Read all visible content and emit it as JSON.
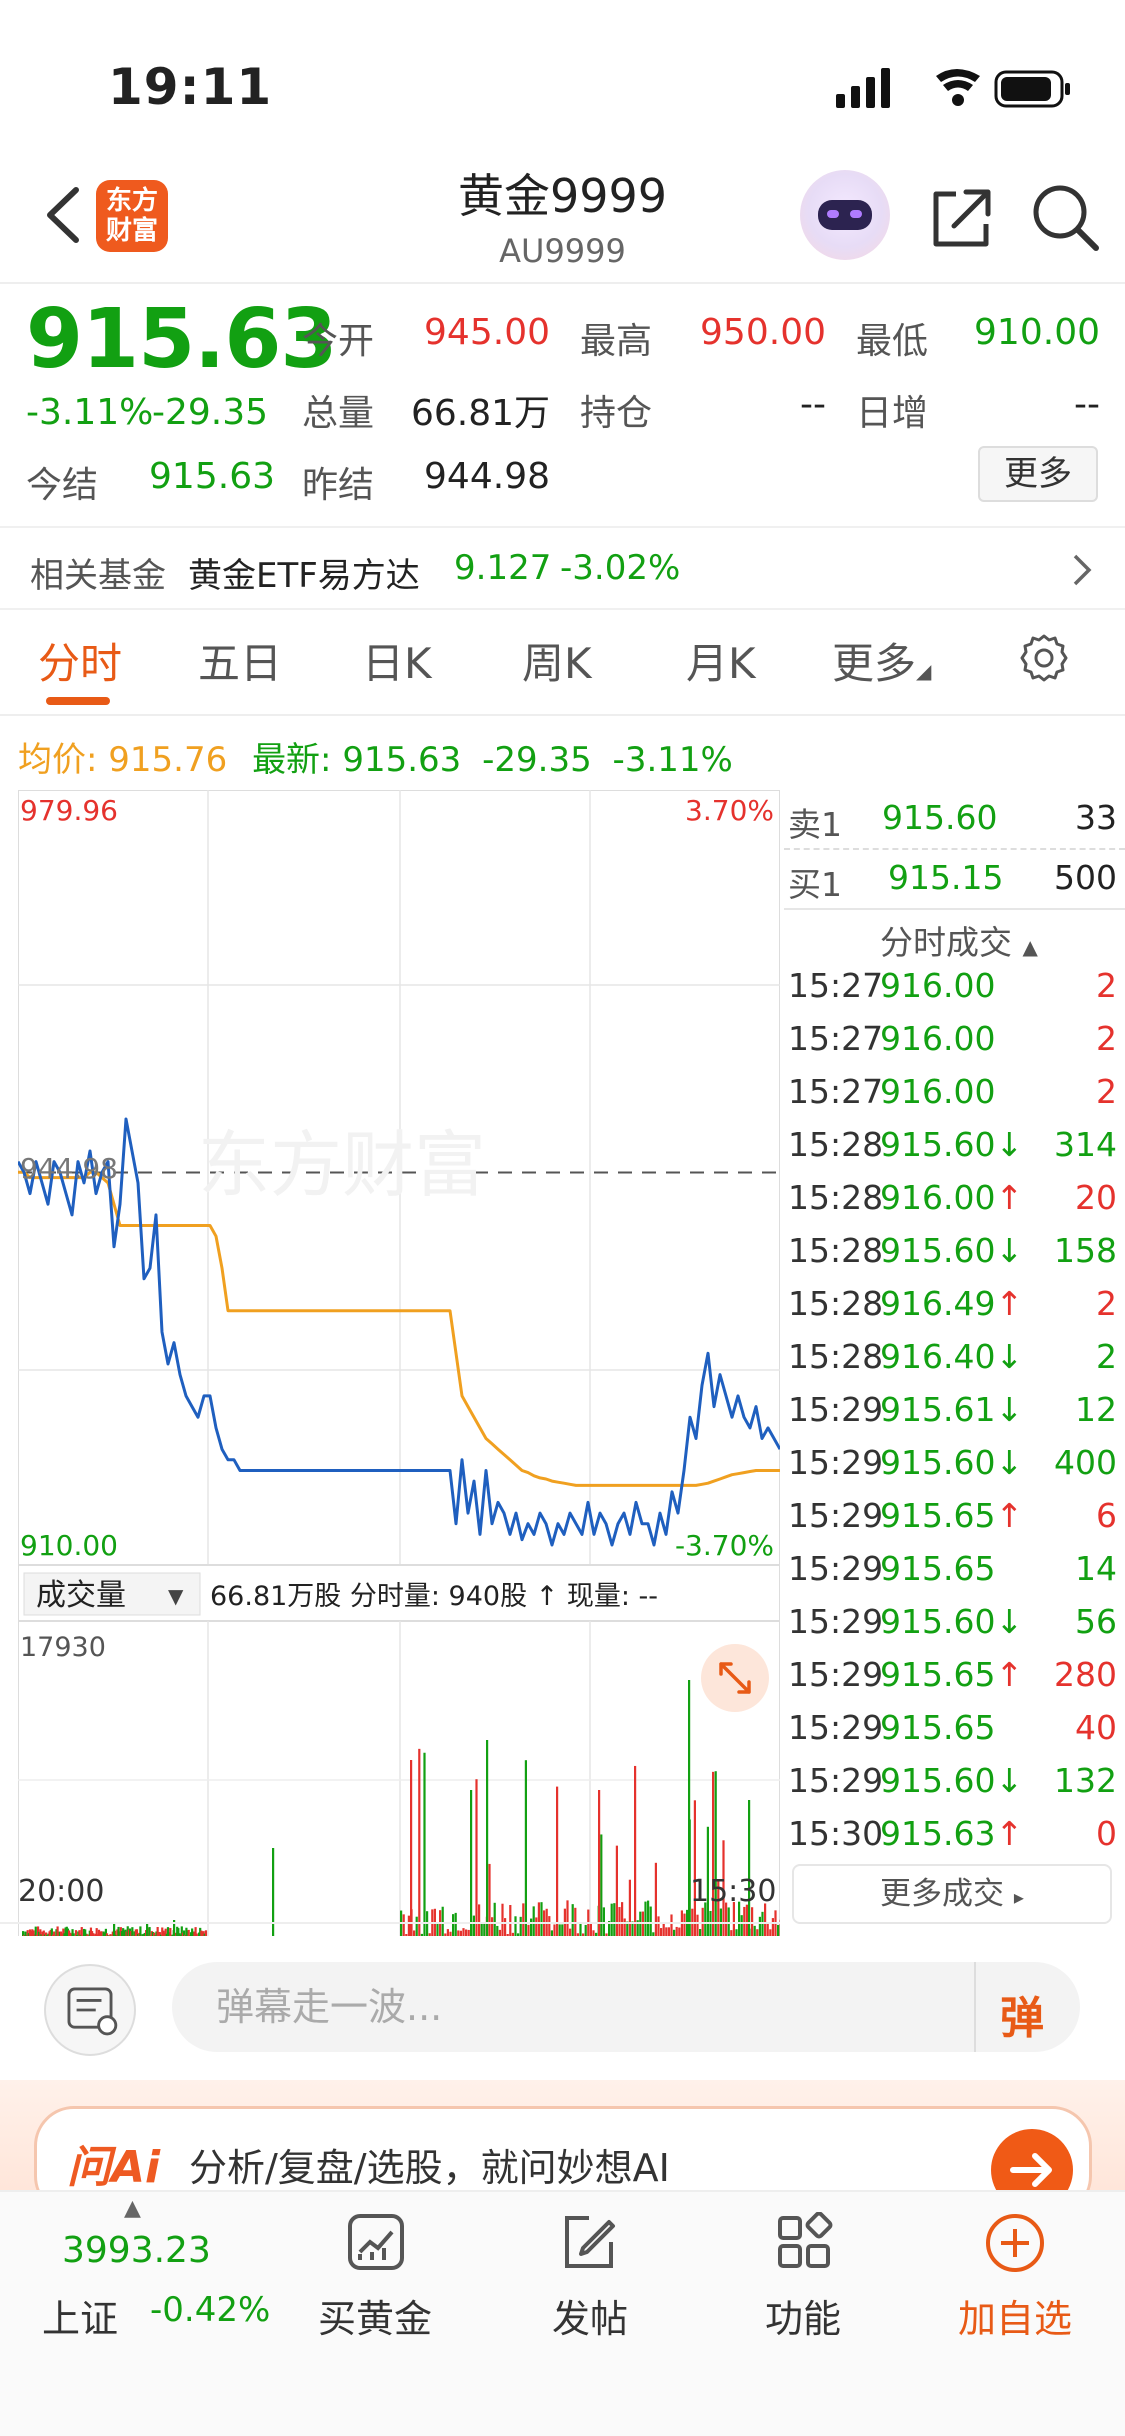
{
  "status_bar": {
    "time": "19:11"
  },
  "nav": {
    "logo_text_1": "东方",
    "logo_text_2": "财富",
    "title": "黄金9999",
    "subtitle": "AU9999"
  },
  "quote": {
    "price": "915.63",
    "change_pct": "-3.11%",
    "change_abs": "-29.35",
    "open_label": "今开",
    "open": "945.00",
    "high_label": "最高",
    "high": "950.00",
    "low_label": "最低",
    "low": "910.00",
    "volume_label": "总量",
    "volume": "66.81万",
    "position_label": "持仓",
    "position": "--",
    "daily_inc_label": "日增",
    "daily_inc": "--",
    "settle_label": "今结",
    "settle": "915.63",
    "prev_settle_label": "昨结",
    "prev_settle": "944.98",
    "more_label": "更多"
  },
  "related_fund": {
    "label": "相关基金",
    "name": "黄金ETF易方达",
    "price": "9.127",
    "change": "-3.02%"
  },
  "tabs": [
    {
      "label": "分时",
      "active": true
    },
    {
      "label": "五日"
    },
    {
      "label": "日K"
    },
    {
      "label": "周K"
    },
    {
      "label": "月K"
    },
    {
      "label": "更多"
    }
  ],
  "indicator_line": {
    "avg_label": "均价:",
    "avg": "915.76",
    "latest_label": "最新:",
    "latest": "915.63",
    "change_abs": "-29.35",
    "change_pct": "-3.11%"
  },
  "chart_data": {
    "type": "line",
    "y_labels": {
      "top_left": "979.96",
      "bottom_left": "910.00",
      "mid_left": "944.98",
      "top_right": "3.70%",
      "bottom_right": "-3.70%"
    },
    "ylim": [
      910.0,
      979.96
    ],
    "reference": 944.98,
    "x_labels": {
      "start": "20:00",
      "end": "15:30"
    },
    "watermark": "东方财富",
    "series": [
      {
        "color": "#1f5fbf",
        "role": "price",
        "values": [
          946,
          945,
          943,
          946,
          944,
          942,
          946,
          945,
          943,
          941,
          946,
          944,
          947,
          943,
          945,
          946,
          938,
          942,
          950,
          947,
          944,
          935,
          936,
          941,
          930,
          927,
          929,
          926,
          924,
          923,
          922,
          924,
          924,
          921,
          919,
          918,
          918,
          917,
          917,
          917,
          917,
          917,
          917,
          917,
          917,
          917,
          917,
          917,
          917,
          917,
          917,
          917,
          917,
          917,
          917,
          917,
          917,
          917,
          917,
          917,
          917,
          917,
          917,
          917,
          917,
          917,
          917,
          917,
          917,
          917,
          917,
          917,
          917,
          912,
          918,
          913,
          916,
          911,
          917,
          912,
          914,
          913,
          911,
          913,
          910.5,
          912,
          911,
          913,
          912,
          910,
          912,
          911,
          913,
          912,
          911,
          914,
          911,
          913,
          912,
          910,
          912,
          913,
          911,
          914,
          912,
          912,
          910,
          913,
          911,
          915,
          913,
          917,
          922,
          920,
          925,
          928,
          923,
          926,
          924,
          922,
          924,
          922,
          921,
          923,
          920,
          921,
          920,
          919
        ]
      },
      {
        "color": "#f0a020",
        "role": "average",
        "values": [
          945,
          945,
          944.5,
          944.5,
          944.5,
          944.5,
          944.5,
          944.5,
          944.5,
          944.5,
          944.5,
          944.5,
          945,
          945,
          944.5,
          944,
          942,
          940,
          940,
          940,
          940,
          940,
          940,
          940,
          940,
          940,
          940,
          940,
          940,
          940,
          940,
          940,
          940,
          939,
          936,
          932,
          932,
          932,
          932,
          932,
          932,
          932,
          932,
          932,
          932,
          932,
          932,
          932,
          932,
          932,
          932,
          932,
          932,
          932,
          932,
          932,
          932,
          932,
          932,
          932,
          932,
          932,
          932,
          932,
          932,
          932,
          932,
          932,
          932,
          932,
          932,
          932,
          932,
          928,
          924,
          923,
          922,
          921,
          920,
          919.5,
          919,
          918.5,
          918,
          917.5,
          917,
          916.8,
          916.5,
          916.3,
          916.2,
          916.0,
          915.9,
          915.8,
          915.7,
          915.6,
          915.6,
          915.6,
          915.6,
          915.6,
          915.6,
          915.6,
          915.6,
          915.6,
          915.6,
          915.6,
          915.6,
          915.6,
          915.6,
          915.6,
          915.6,
          915.6,
          915.6,
          915.6,
          915.6,
          915.6,
          915.7,
          915.8,
          916,
          916.2,
          916.4,
          916.6,
          916.7,
          916.8,
          916.9,
          917,
          917,
          917,
          917,
          917
        ]
      }
    ],
    "volume_label": "成交量",
    "volume_total": "66.81万股",
    "minute_volume_label": "分时量:",
    "minute_volume": "940股",
    "current_volume_label": "现量:",
    "current_volume": "--",
    "volume_max": "17930"
  },
  "orderbook": {
    "ask": {
      "label": "卖1",
      "price": "915.60",
      "vol": "33"
    },
    "bid": {
      "label": "买1",
      "price": "915.15",
      "vol": "500"
    },
    "trades_title": "分时成交",
    "trades": [
      {
        "time": "15:27",
        "price": "916.00",
        "dir": "",
        "vol": "2",
        "color": "red"
      },
      {
        "time": "15:27",
        "price": "916.00",
        "dir": "",
        "vol": "2",
        "color": "red"
      },
      {
        "time": "15:27",
        "price": "916.00",
        "dir": "",
        "vol": "2",
        "color": "red"
      },
      {
        "time": "15:28",
        "price": "915.60",
        "dir": "↓",
        "vol": "314",
        "color": "green"
      },
      {
        "time": "15:28",
        "price": "916.00",
        "dir": "↑",
        "vol": "20",
        "color": "red"
      },
      {
        "time": "15:28",
        "price": "915.60",
        "dir": "↓",
        "vol": "158",
        "color": "green"
      },
      {
        "time": "15:28",
        "price": "916.49",
        "dir": "↑",
        "vol": "2",
        "color": "red"
      },
      {
        "time": "15:28",
        "price": "916.40",
        "dir": "↓",
        "vol": "2",
        "color": "green"
      },
      {
        "time": "15:29",
        "price": "915.61",
        "dir": "↓",
        "vol": "12",
        "color": "green"
      },
      {
        "time": "15:29",
        "price": "915.60",
        "dir": "↓",
        "vol": "400",
        "color": "green"
      },
      {
        "time": "15:29",
        "price": "915.65",
        "dir": "↑",
        "vol": "6",
        "color": "red"
      },
      {
        "time": "15:29",
        "price": "915.65",
        "dir": "",
        "vol": "14",
        "color": "green"
      },
      {
        "time": "15:29",
        "price": "915.60",
        "dir": "↓",
        "vol": "56",
        "color": "green"
      },
      {
        "time": "15:29",
        "price": "915.65",
        "dir": "↑",
        "vol": "280",
        "color": "red"
      },
      {
        "time": "15:29",
        "price": "915.65",
        "dir": "",
        "vol": "40",
        "color": "red"
      },
      {
        "time": "15:29",
        "price": "915.60",
        "dir": "↓",
        "vol": "132",
        "color": "green"
      },
      {
        "time": "15:30",
        "price": "915.63",
        "dir": "↑",
        "vol": "0",
        "color": "red"
      }
    ],
    "more_trades_label": "更多成交"
  },
  "danmaku": {
    "placeholder": "弹幕走一波...",
    "button": "弹"
  },
  "ai_banner": {
    "brand": "问Ai",
    "text": "分析/复盘/选股，就问妙想AI"
  },
  "bottom_bar": {
    "index_value": "3993.23",
    "index_name": "上证",
    "index_change": "-0.42%",
    "items": [
      {
        "label": "买黄金",
        "icon": "chart-icon"
      },
      {
        "label": "发帖",
        "icon": "edit-icon"
      },
      {
        "label": "功能",
        "icon": "grid-icon"
      },
      {
        "label": "加自选",
        "icon": "plus-circle-icon"
      }
    ]
  },
  "colors": {
    "up": "#e5322d",
    "down": "#12a012",
    "accent": "#e85a16",
    "price_line": "#1f5fbf",
    "avg_line": "#f0a020"
  }
}
